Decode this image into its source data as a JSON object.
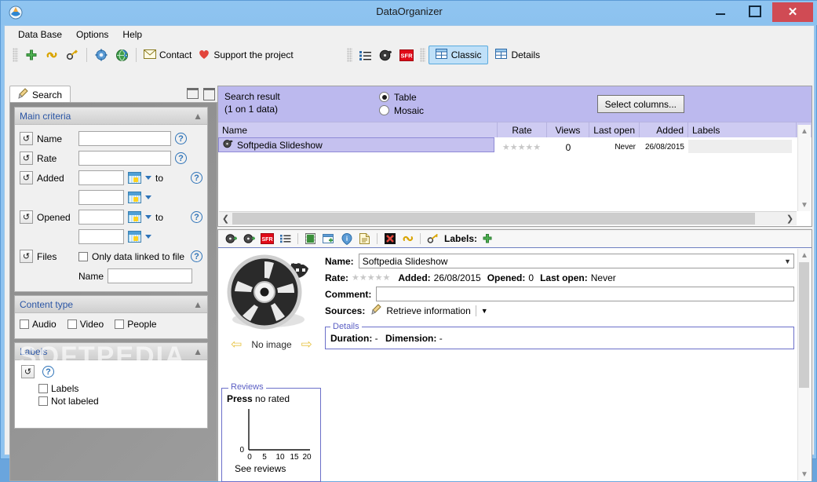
{
  "window": {
    "title": "DataOrganizer",
    "icon": "app-icon",
    "buttons": {
      "minimize": "–",
      "maximize": "□",
      "close": "✕"
    }
  },
  "menu": {
    "items": [
      "Data Base",
      "Options",
      "Help"
    ]
  },
  "toolbar": {
    "icons": [
      "add-icon",
      "link-broken-icon",
      "key-icon",
      "settings-icon",
      "globe-icon"
    ],
    "contact_label": "Contact",
    "support_label": "Support the project",
    "view_icons": [
      "list-icon",
      "film-icon",
      "sfr-icon"
    ],
    "views": [
      {
        "label": "Classic",
        "active": true
      },
      {
        "label": "Details",
        "active": false
      }
    ]
  },
  "search_tab": {
    "label": "Search",
    "icon": "brush-icon"
  },
  "main_criteria": {
    "title": "Main criteria",
    "rows": [
      {
        "label": "Name",
        "value": "",
        "help": "?"
      },
      {
        "label": "Rate",
        "value": "",
        "help": "?"
      }
    ],
    "added": {
      "label": "Added",
      "from": "",
      "to_label": "to",
      "to": "",
      "help": "?"
    },
    "opened": {
      "label": "Opened",
      "from": "",
      "to_label": "to",
      "to": "",
      "help": "?"
    },
    "files": {
      "label": "Files",
      "checkbox_label": "Only data linked to file",
      "checked": false,
      "name_label": "Name",
      "name_value": "",
      "help": "?"
    }
  },
  "content_type": {
    "title": "Content type",
    "options": [
      {
        "label": "Audio",
        "checked": false
      },
      {
        "label": "Video",
        "checked": false
      },
      {
        "label": "People",
        "checked": false
      }
    ]
  },
  "labels_panel": {
    "title": "Labels",
    "help": "?",
    "options": [
      {
        "label": "Labels",
        "checked": false
      },
      {
        "label": "Not labeled",
        "checked": false
      }
    ]
  },
  "watermark": "SOFTPEDIA",
  "search_result": {
    "title": "Search result",
    "subtitle": "(1 on 1 data)",
    "view_modes": [
      {
        "label": "Table",
        "selected": true
      },
      {
        "label": "Mosaic",
        "selected": false
      }
    ],
    "select_columns_label": "Select columns...",
    "columns": [
      "Name",
      "Rate",
      "Views",
      "Last open",
      "Added",
      "Labels"
    ],
    "rows": [
      {
        "name": "Softpedia Slideshow",
        "rate": "★★★★★",
        "views": "0",
        "last_open": "Never",
        "added": "26/08/2015",
        "labels": "",
        "selected": true
      }
    ]
  },
  "details": {
    "toolbar_icons": [
      "film-add-icon",
      "film-add2-icon",
      "sfr-icon",
      "list-icon",
      "filmstrip-icon",
      "window-add-icon",
      "info-icon",
      "document-icon",
      "delete-x-icon",
      "link-broken-icon",
      "key-icon"
    ],
    "labels_label": "Labels:",
    "labels_add_icon": "plus-icon",
    "thumbnail": {
      "icon": "film-reel-icon",
      "caption": "No image",
      "prev": "⇦",
      "next": "⇨"
    },
    "name_label": "Name:",
    "name_value": "Softpedia Slideshow",
    "rate_label": "Rate:",
    "rate_stars": "★★★★★",
    "added_label": "Added:",
    "added_value": "26/08/2015",
    "opened_label": "Opened:",
    "opened_value": "0",
    "last_open_label": "Last open:",
    "last_open_value": "Never",
    "comment_label": "Comment:",
    "comment_value": "",
    "sources_label": "Sources:",
    "retrieve_label": "Retrieve information",
    "retrieve_icon": "brush-icon",
    "details_legend": "Details",
    "duration_label": "Duration:",
    "duration_value": "-",
    "dimension_label": "Dimension:",
    "dimension_value": "-"
  },
  "reviews": {
    "legend": "Reviews",
    "press_label": "Press",
    "status": "no rated",
    "see_reviews": "See reviews",
    "y_zero": "0",
    "x_ticks": [
      "0",
      "5",
      "10",
      "15",
      "20"
    ]
  },
  "chart_data": {
    "type": "bar",
    "title": "Press no rated",
    "categories": [
      "0",
      "5",
      "10",
      "15",
      "20"
    ],
    "values": [
      0,
      0,
      0,
      0,
      0
    ],
    "xlabel": "",
    "ylabel": "",
    "ylim": [
      0,
      1
    ],
    "xlim": [
      0,
      20
    ],
    "grid": false,
    "legend": "none",
    "annotations": [
      "no rated"
    ]
  },
  "colors": {
    "title_bar": "#8ec3f0",
    "accent_purple": "#bcb9ee",
    "grid_header": "#cecbf2",
    "selection": "#c5c1ef",
    "close_button": "#d04b54",
    "group_header_text": "#2b56a5",
    "fieldset_border": "#6b6fc9"
  }
}
